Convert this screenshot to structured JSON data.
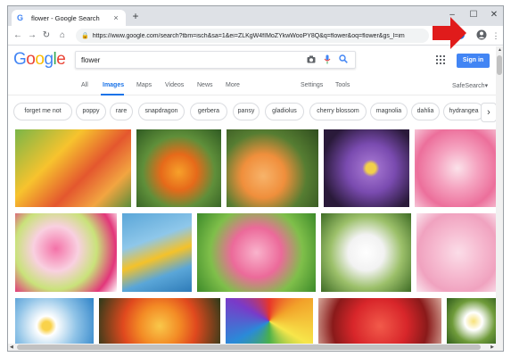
{
  "browser": {
    "tab_title": "flower - Google Search",
    "tab_favicon": "G",
    "tab_close": "×",
    "new_tab": "+",
    "window_controls": [
      "–",
      "☐",
      "✕"
    ],
    "url": "https://www.google.com/search?tbm=isch&sa=1&ei=ZLKgW4fIMoZYkwWooPY8Q&q=flower&oq=flower&gs_l=im"
  },
  "google": {
    "logo_letters": [
      {
        "ch": "G",
        "color": "#4285f4"
      },
      {
        "ch": "o",
        "color": "#ea4335"
      },
      {
        "ch": "o",
        "color": "#fbbc05"
      },
      {
        "ch": "g",
        "color": "#4285f4"
      },
      {
        "ch": "l",
        "color": "#34a853"
      },
      {
        "ch": "e",
        "color": "#ea4335"
      }
    ],
    "query": "flower",
    "sign_in": "Sign in",
    "tabs": [
      "All",
      "Images",
      "Maps",
      "Videos",
      "News",
      "More"
    ],
    "active_tab": "Images",
    "settings": "Settings",
    "tools": "Tools",
    "safesearch": "SafeSearch▾",
    "chips": [
      "forget me not",
      "poppy",
      "rare",
      "snapdragon",
      "gerbera",
      "pansy",
      "gladiolus",
      "cherry blossom",
      "magnolia",
      "dahlia",
      "hydrangea"
    ],
    "chip_next": "›"
  },
  "images": [
    {
      "name": "butterfly-flowers",
      "bg": "linear-gradient(135deg,#7ab648 0%,#f7c32e 35%,#e4572e 60%,#f2a541 80%,#5b8c3a 100%)"
    },
    {
      "name": "orange-lily",
      "bg": "radial-gradient(circle at 50% 55%,#f7a12a 0%,#e66a1a 30%,#5f8f3a 60%,#2f5a22 100%)"
    },
    {
      "name": "peach-roses",
      "bg": "radial-gradient(circle at 40% 60%,#f7b36a 0%,#f08f3c 30%,#567d32 60%,#2f4d1e 100%)"
    },
    {
      "name": "purple-daisy",
      "bg": "radial-gradient(circle at 55% 50%,#f2d04a 0%,#f2d04a 8%,#9b6cc9 14%,#7a4bb0 40%,#2a1a3a 80%)"
    },
    {
      "name": "pink-dahlia",
      "bg": "radial-gradient(circle at 50% 50%,#fbe2ea 0%,#f5a3c0 35%,#ec6f9b 70%,#f6c4d6 100%)"
    },
    {
      "name": "bouquet",
      "bg": "radial-gradient(circle at 40% 45%,#f472a8 0%,#f9d0e0 30%,#c9e27a 55%,#e2367a 80%,#ffffff 100%)"
    },
    {
      "name": "yellow-flower-sky",
      "bg": "linear-gradient(160deg,#5aa6d8 0%,#8ec7ea 35%,#f4c22a 55%,#5aa6d8 75%,#2e7bb8 100%)"
    },
    {
      "name": "pink-lotus",
      "bg": "radial-gradient(circle at 50% 50%,#f9b3cc 0%,#ec6a9a 35%,#7fbf4a 65%,#3d8a2a 100%)"
    },
    {
      "name": "white-clematis",
      "bg": "radial-gradient(circle at 50% 50%,#ffffff 0%,#f2f2f2 30%,#9cc06a 60%,#3e6b25 100%)"
    },
    {
      "name": "cherry-blossom",
      "bg": "radial-gradient(circle at 50% 50%,#fbdde8 0%,#f6bad0 40%,#f0a2bf 70%,#fae6ee 100%)"
    },
    {
      "name": "white-daisies",
      "bg": "radial-gradient(circle at 40% 60%,#f9d24a 0%,#f9d24a 8%,#ffffff 18%,#8fc3e7 55%,#2e83c8 100%)"
    },
    {
      "name": "orange-gerbera",
      "bg": "radial-gradient(circle at 50% 60%,#f9c84a 0%,#f38b25 30%,#e0491e 55%,#2a3a1a 100%)"
    },
    {
      "name": "rainbow-flower",
      "bg": "conic-gradient(from 0deg,#e8352a,#f2a32a,#f7e64a,#4ab04a,#2a8ad8,#7a3ac8,#e8352a)"
    },
    {
      "name": "red-dahlia",
      "bg": "radial-gradient(circle at 50% 60%,#f25a4a 0%,#d8262a 40%,#8a1a1a 70%,#d6a89a 100%)"
    },
    {
      "name": "white-frangipani",
      "bg": "radial-gradient(circle at 50% 50%,#f7e27a 0%,#ffffff 25%,#6f9b3a 60%,#2e5a1c 100%)"
    }
  ]
}
